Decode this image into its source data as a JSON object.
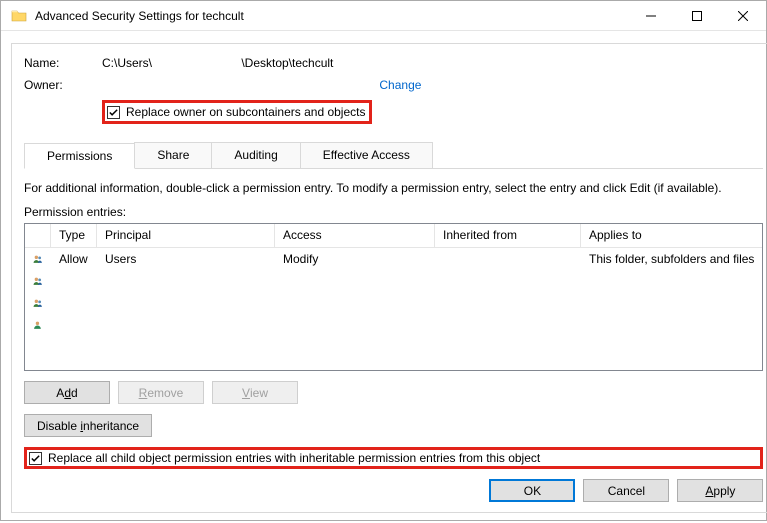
{
  "titlebar": {
    "title": "Advanced Security Settings for techcult"
  },
  "header": {
    "name_label": "Name:",
    "path_a": "C:\\Users\\",
    "path_b": "\\Desktop\\techcult",
    "owner_label": "Owner:",
    "change_link": "Change",
    "replace_owner_label": "Replace owner on subcontainers and objects"
  },
  "tabs": {
    "permissions": "Permissions",
    "share": "Share",
    "auditing": "Auditing",
    "effective": "Effective Access"
  },
  "info": "For additional information, double-click a permission entry. To modify a permission entry, select the entry and click Edit (if available).",
  "entries_label": "Permission entries:",
  "cols": {
    "type": "Type",
    "principal": "Principal",
    "access": "Access",
    "inherited": "Inherited from",
    "applies": "Applies to"
  },
  "rows": [
    {
      "type": "Allow",
      "principal": "Users",
      "access": "Modify",
      "inherited": "",
      "applies": "This folder, subfolders and files",
      "icon": "group"
    },
    {
      "type": "",
      "principal": "",
      "access": "",
      "inherited": "",
      "applies": "",
      "icon": "group"
    },
    {
      "type": "",
      "principal": "",
      "access": "",
      "inherited": "",
      "applies": "",
      "icon": "group"
    },
    {
      "type": "",
      "principal": "",
      "access": "",
      "inherited": "",
      "applies": "",
      "icon": "user"
    }
  ],
  "buttons": {
    "add": "Add",
    "remove": "Remove",
    "view": "View",
    "disable_inh": "Disable inheritance",
    "ok": "OK",
    "cancel": "Cancel",
    "apply": "Apply"
  },
  "replace_child_label": "Replace all child object permission entries with inheritable permission entries from this object"
}
